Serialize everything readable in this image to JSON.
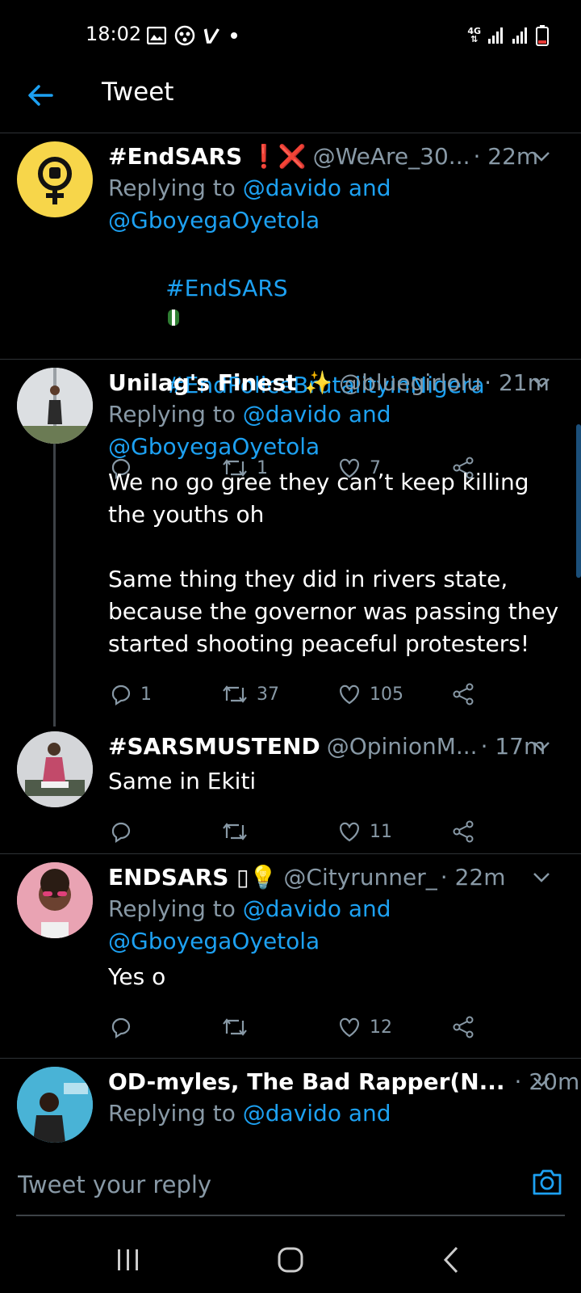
{
  "status": {
    "time": "18:02",
    "network": "4G"
  },
  "header": {
    "title": "Tweet"
  },
  "tweets": [
    {
      "name": "#EndSARS ❗❌",
      "handle": "@WeAre_30...",
      "time": "· 22m",
      "reply_prefix": "Replying to ",
      "reply_mentions": "@davido and @GboyegaOyetola",
      "text_1": "#EndSARS",
      "text_2": "#EndPoliceBrutalityinNigera",
      "replies": "",
      "retweets": "1",
      "likes": "7"
    },
    {
      "name": "Unilag's Finest ✨",
      "handle": "@bluegirlolu",
      "time": "· 21m",
      "reply_prefix": "Replying to ",
      "reply_mentions": "@davido and @GboyegaOyetola",
      "text": "We no go gree they can’t keep killing the youths oh\n\nSame thing they did in rivers state, because the governor was passing they started shooting peaceful protesters!",
      "replies": "1",
      "retweets": "37",
      "likes": "105"
    },
    {
      "name": "#SARSMUSTEND",
      "handle": "@OpinionM...",
      "time": "· 17m",
      "text": "Same in Ekiti",
      "replies": "",
      "retweets": "",
      "likes": "11"
    },
    {
      "name": "ENDSARS ▯💡",
      "handle": "@Cityrunner_",
      "time": "· 22m",
      "reply_prefix": "Replying to ",
      "reply_mentions": "@davido and @GboyegaOyetola",
      "text": "Yes o",
      "replies": "",
      "retweets": "",
      "likes": "12"
    },
    {
      "name": "OD-myles, The Bad Rapper(N...",
      "handle": "",
      "time": "· 20m",
      "reply_prefix": "Replying to ",
      "reply_mentions": "@davido and"
    }
  ],
  "reply_bar": {
    "placeholder": "Tweet your reply"
  },
  "colors": {
    "accent": "#1da1f2",
    "muted": "#8899a6",
    "background": "#000000",
    "divider": "#2f3336"
  }
}
